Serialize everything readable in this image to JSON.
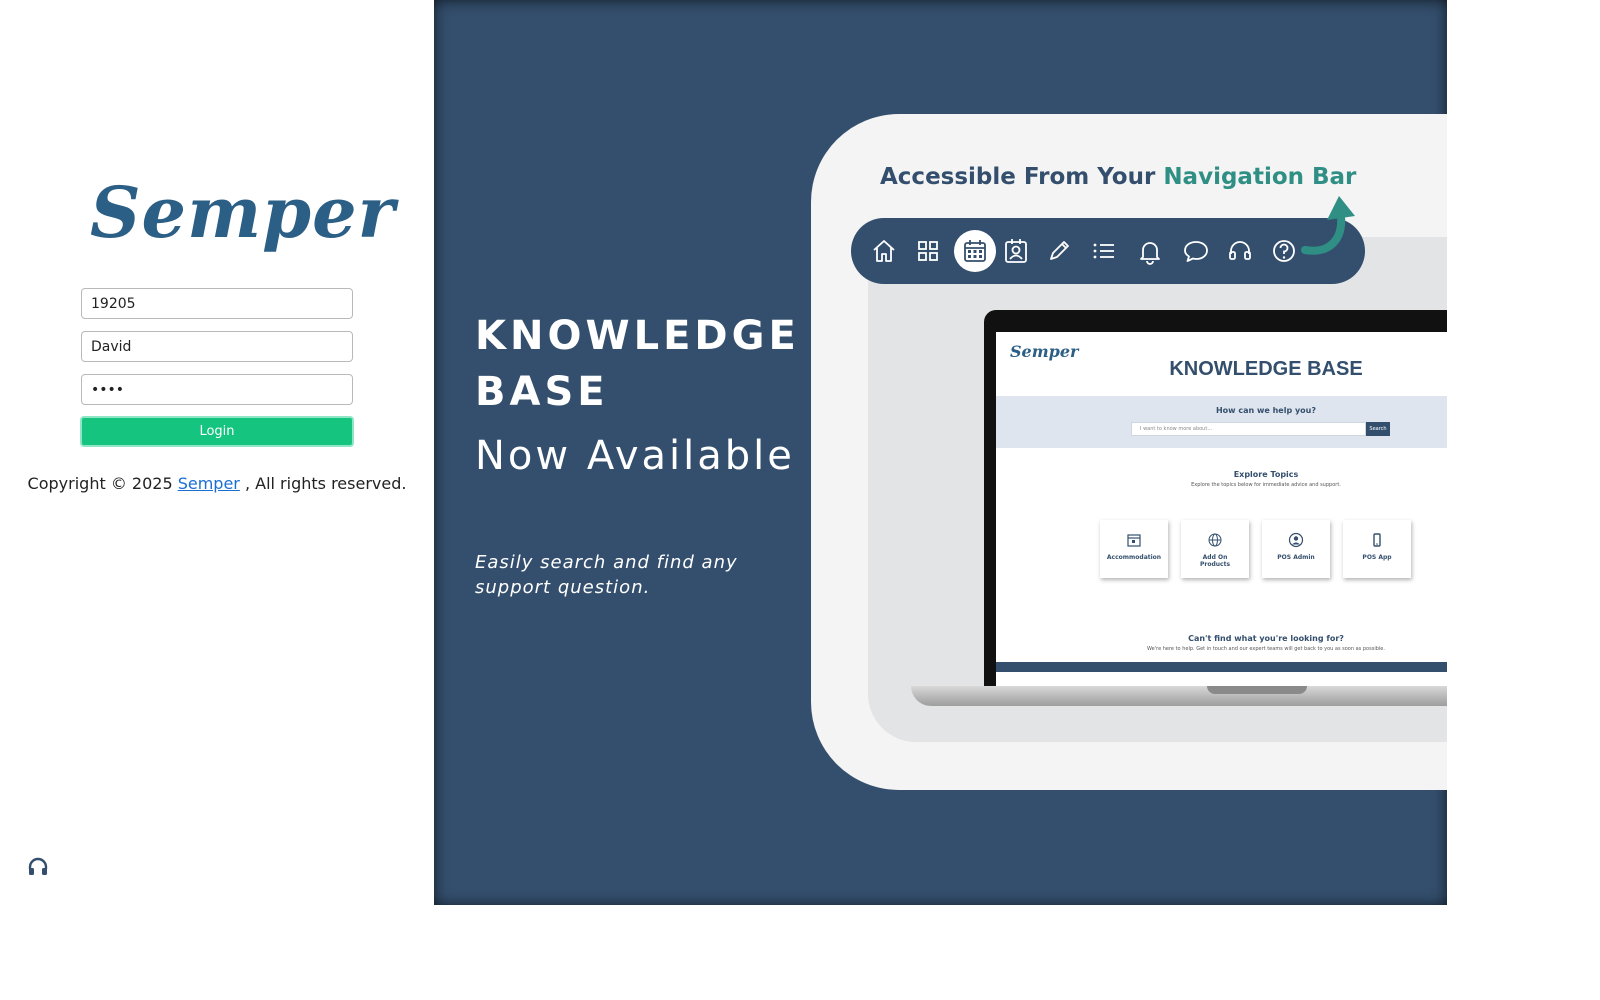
{
  "login": {
    "logo_text": "Semper",
    "company_id_value": "19205",
    "username_value": "David",
    "password_value": "1234",
    "login_label": "Login",
    "copyright_prefix": "Copyright © 2025 ",
    "copyright_link": "Semper",
    "copyright_suffix": " , All rights reserved.",
    "support_icon": "headset-icon"
  },
  "banner": {
    "title": "KNOWLEDGE BASE",
    "subtitle": "Now Available",
    "tagline": "Easily search and find any support question.",
    "nav_caption_prefix": "Accessible From Your ",
    "nav_caption_highlight": "Navigation Bar",
    "nav_icons": [
      "home-icon",
      "grid-icon",
      "calendar-icon",
      "contact-icon",
      "pencil-icon",
      "list-icon",
      "bell-icon",
      "chat-icon",
      "headset-icon",
      "help-icon"
    ],
    "active_nav_icon": "calendar-icon"
  },
  "screen": {
    "logo": "Semper",
    "title": "KNOWLEDGE BASE",
    "help_heading": "How can we help you?",
    "search_placeholder": "I want to know more about...",
    "search_button": "Search",
    "explore_heading": "Explore Topics",
    "explore_sub": "Explore the topics below for immediate advice and support.",
    "topics": [
      "Accommodation",
      "Add On Products",
      "POS Admin",
      "POS App"
    ],
    "cant_find_heading": "Can't find what you're looking for?",
    "cant_find_sub": "We're here to help. Get in touch and our expert teams will get back to you as soon as possible."
  },
  "colors": {
    "brand_navy": "#344f6d",
    "brand_teal": "#2f8f85",
    "login_green": "#14c47f",
    "logo_blue": "#2b5f86"
  }
}
